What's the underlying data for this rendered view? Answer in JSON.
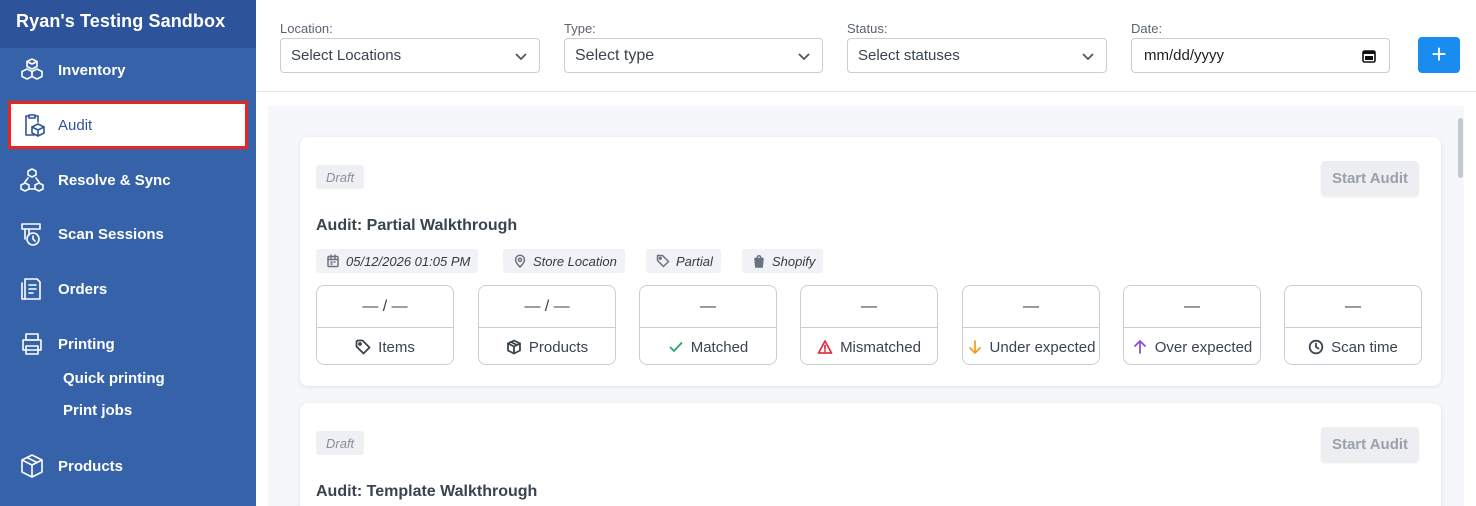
{
  "app": {
    "title": "Ryan's Testing Sandbox"
  },
  "sidebar": {
    "items": [
      {
        "label": "Inventory",
        "icon": "boxes-icon"
      },
      {
        "label": "Audit",
        "icon": "audit-clipboard-icon",
        "active": true
      },
      {
        "label": "Resolve & Sync",
        "icon": "resolve-sync-icon"
      },
      {
        "label": "Scan Sessions",
        "icon": "scan-sessions-icon"
      },
      {
        "label": "Orders",
        "icon": "orders-icon"
      },
      {
        "label": "Printing",
        "icon": "printer-icon"
      },
      {
        "label": "Products",
        "icon": "product-box-icon"
      }
    ],
    "printing_sub": [
      "Quick printing",
      "Print jobs"
    ]
  },
  "filters": {
    "location": {
      "label": "Location:",
      "placeholder": "Select Locations"
    },
    "type": {
      "label": "Type:",
      "placeholder": "Select type"
    },
    "status": {
      "label": "Status:",
      "placeholder": "Select statuses"
    },
    "date": {
      "label": "Date:",
      "placeholder": "mm/dd/yyyy"
    },
    "add_label": "+"
  },
  "audits": [
    {
      "status": "Draft",
      "action": "Start Audit",
      "title": "Audit: Partial Walkthrough",
      "meta": {
        "datetime": "05/12/2026 01:05 PM",
        "location": "Store Location",
        "type": "Partial",
        "integration": "Shopify"
      },
      "stats": [
        {
          "value": "— / —",
          "label": "Items",
          "icon": "tag-icon"
        },
        {
          "value": "— / —",
          "label": "Products",
          "icon": "cube-icon"
        },
        {
          "value": "—",
          "label": "Matched",
          "icon": "check-icon",
          "color": "#1faa6b"
        },
        {
          "value": "—",
          "label": "Mismatched",
          "icon": "warning-icon",
          "color": "#e0334a"
        },
        {
          "value": "—",
          "label": "Under expected",
          "icon": "arrow-down-icon",
          "color": "#f0a020"
        },
        {
          "value": "—",
          "label": "Over expected",
          "icon": "arrow-up-icon",
          "color": "#8a4fe0"
        },
        {
          "value": "—",
          "label": "Scan time",
          "icon": "clock-icon"
        }
      ]
    },
    {
      "status": "Draft",
      "action": "Start Audit",
      "title": "Audit: Template Walkthrough"
    }
  ],
  "colors": {
    "sidebar": "#3562a8",
    "accent": "#1a8cf0",
    "active_border": "#e8261d"
  }
}
